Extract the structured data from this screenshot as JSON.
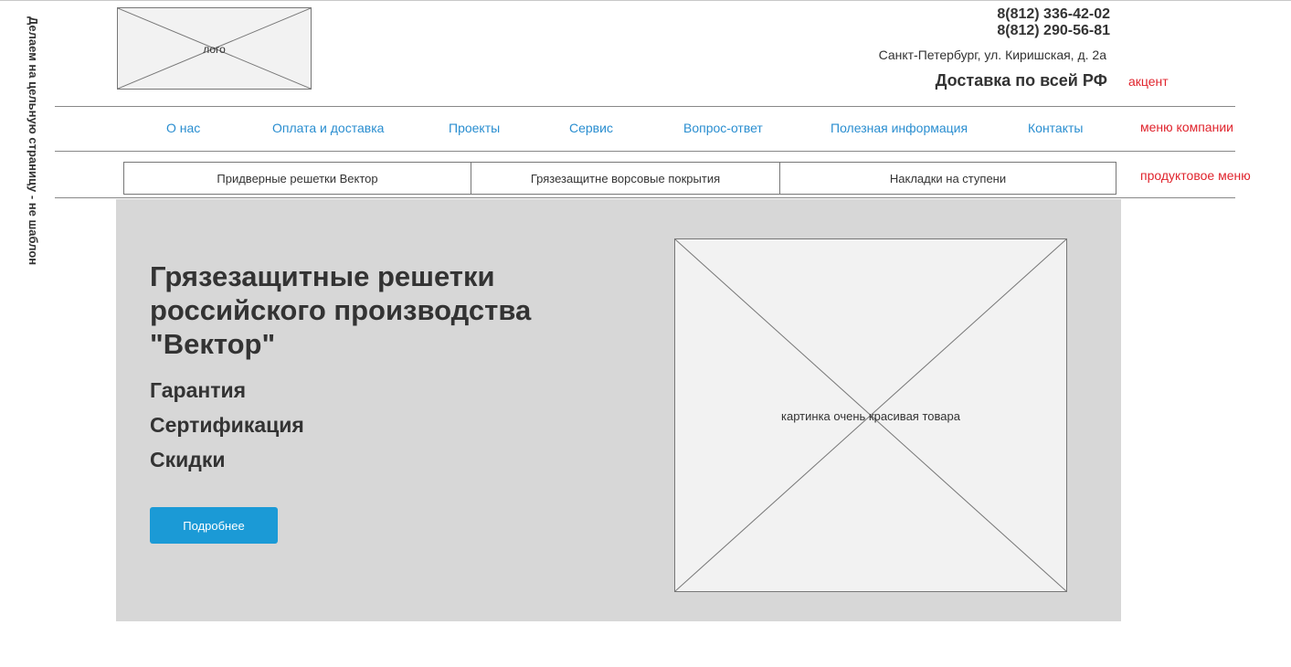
{
  "side_note": "Делаем на цельную страницу - не шаблон",
  "header": {
    "logo_label": "лого",
    "phones": [
      "8(812) 336-42-02",
      "8(812) 290-56-81"
    ],
    "address": "Санкт-Петербург, ул. Киришская, д. 2а",
    "delivery": "Доставка по всей РФ",
    "accent_note": "акцент"
  },
  "company_menu": {
    "note": "меню компании",
    "items": [
      "О нас",
      "Оплата и доставка",
      "Проекты",
      "Сервис",
      "Вопрос-ответ",
      "Полезная информация",
      "Контакты"
    ]
  },
  "product_menu": {
    "note": "продуктовое меню",
    "items": [
      "Придверные решетки Вектор",
      "Грязезащитне ворсовые покрытия",
      "Накладки на ступени"
    ]
  },
  "hero": {
    "title": "Грязезащитные решетки российского производства \"Вектор\"",
    "features": [
      "Гарантия",
      "Сертификация",
      "Скидки"
    ],
    "button_label": "Подробнее",
    "image_label": "картинка очень красивая товара"
  },
  "colors": {
    "link": "#2a8ed0",
    "note": "#e0242d",
    "button": "#1b9ad6",
    "hero_bg": "#d7d7d7"
  }
}
